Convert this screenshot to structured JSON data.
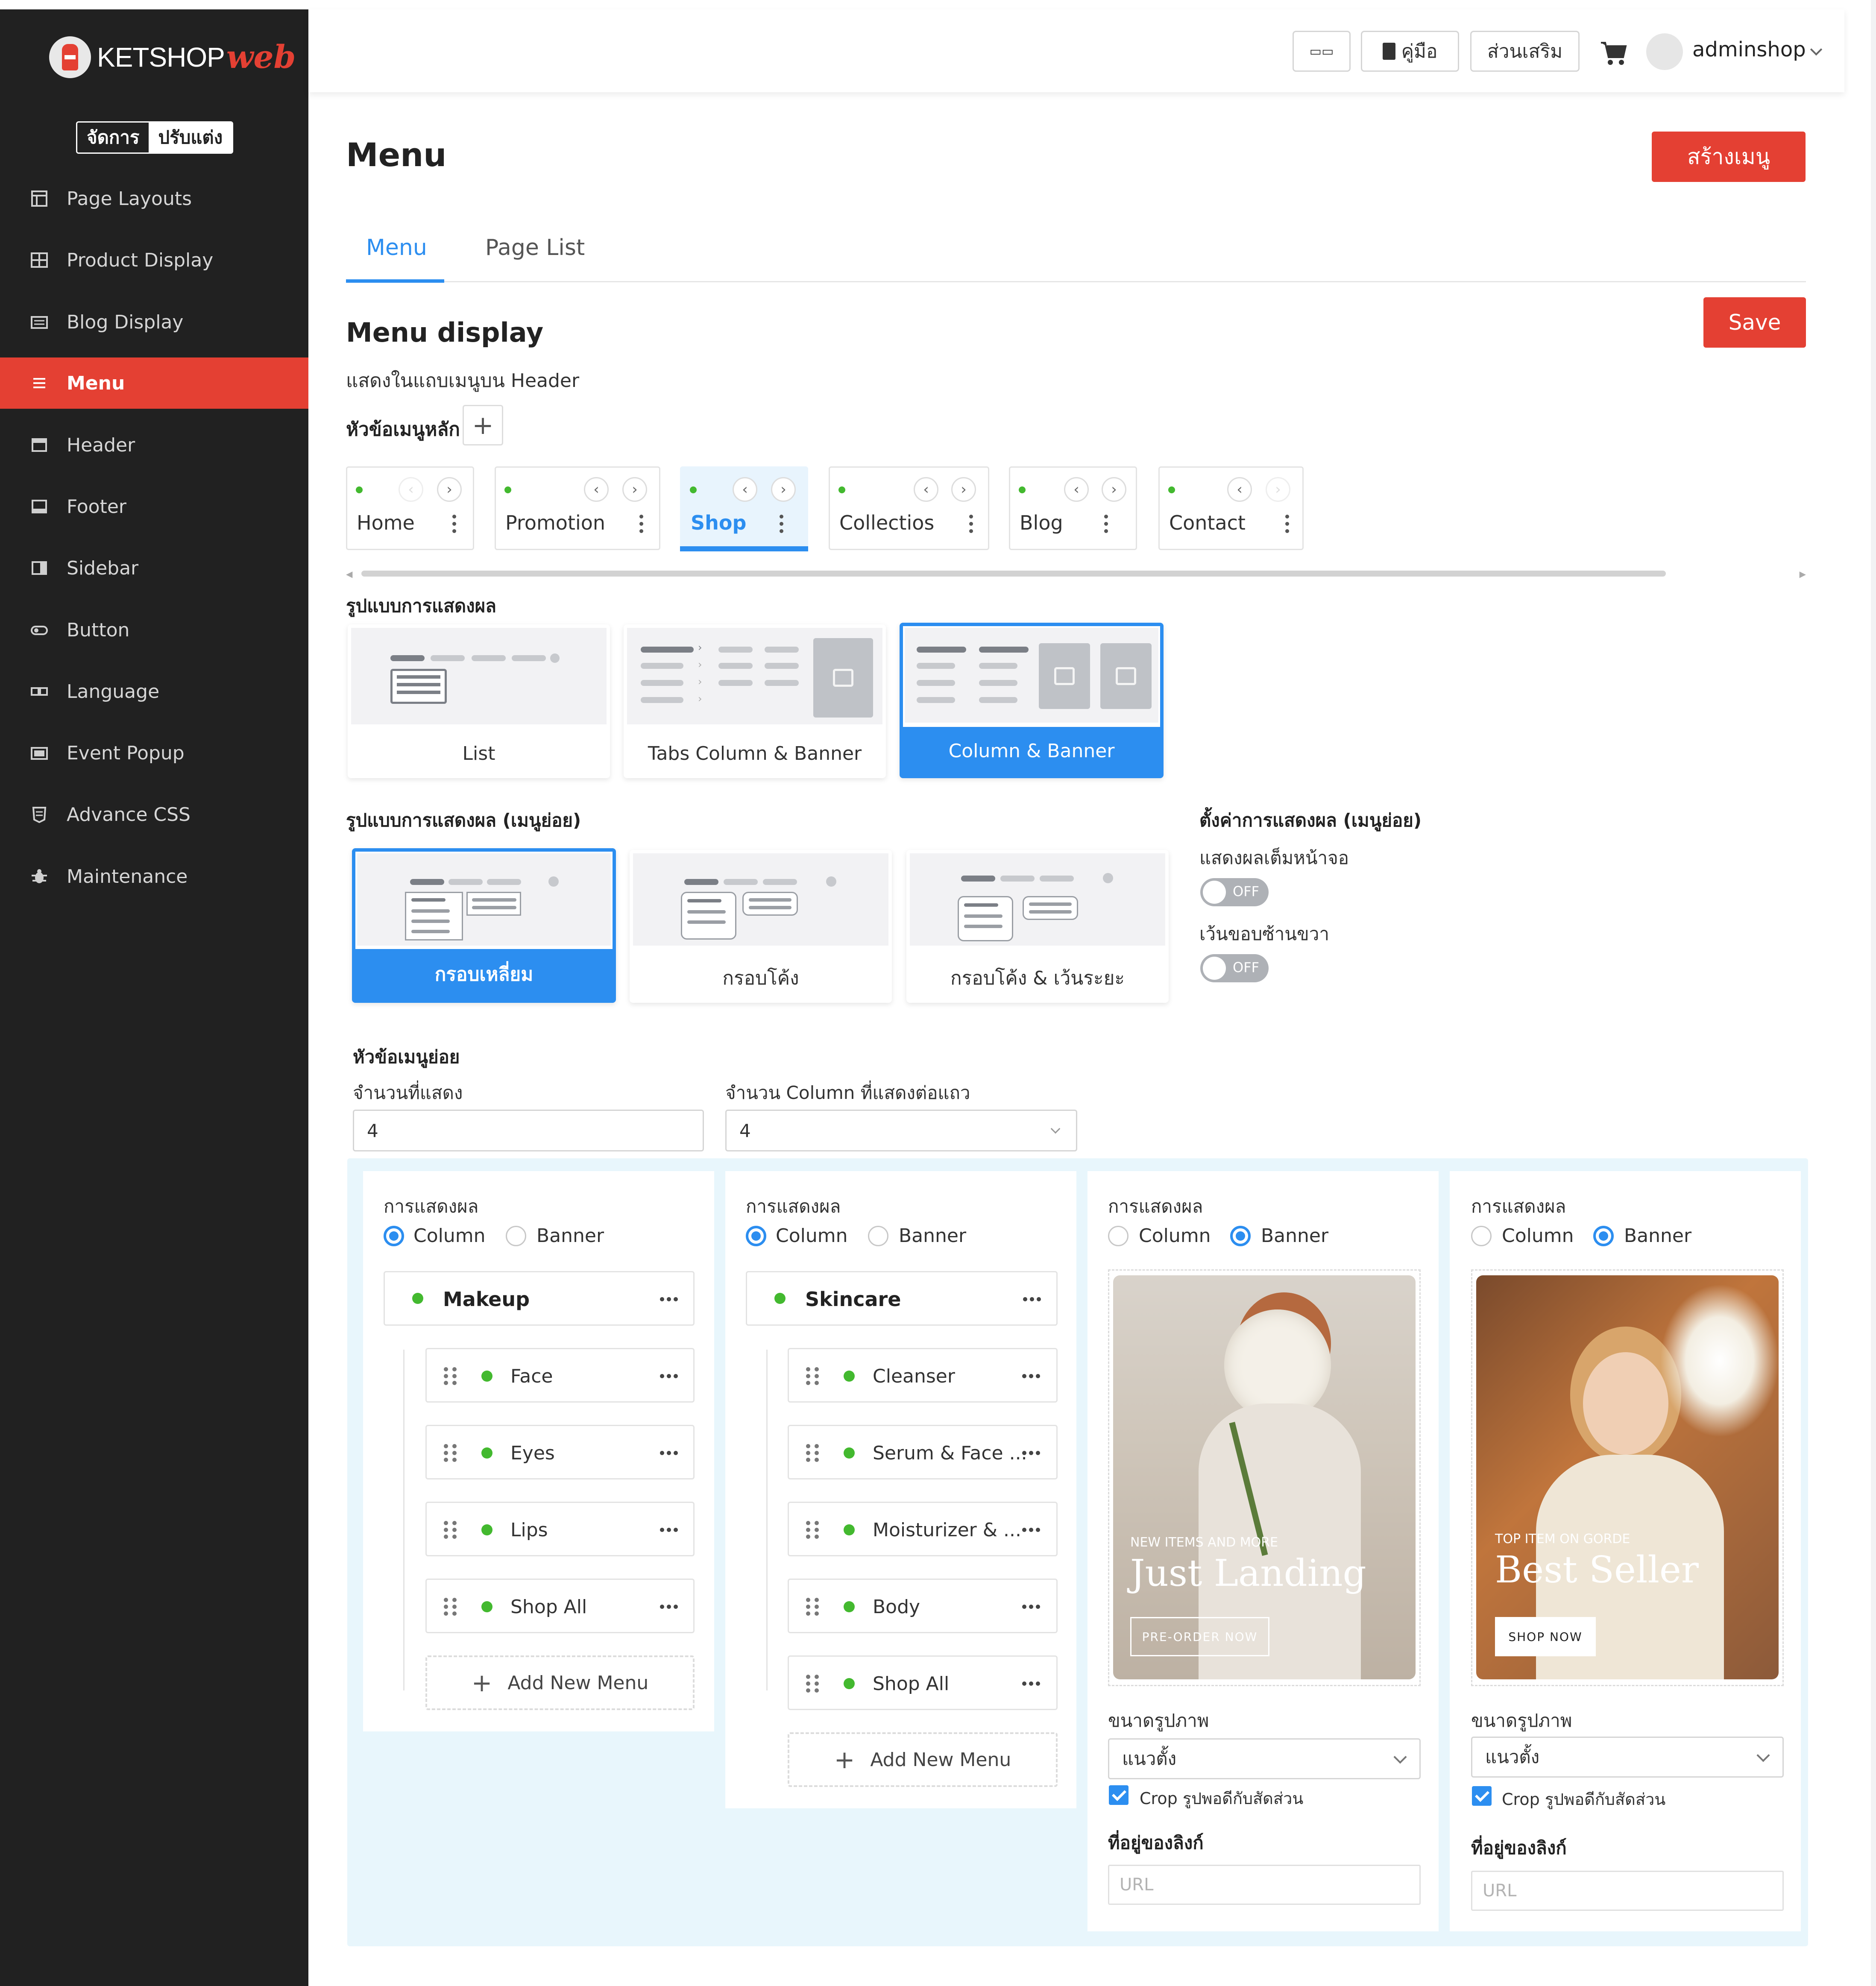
{
  "sidebar": {
    "logo_text": "KETSHOP",
    "logo_web": "web",
    "mode_manage": "จัดการ",
    "mode_customize": "ปรับแต่ง",
    "items": [
      {
        "label": "Page Layouts",
        "icon": "layout-icon"
      },
      {
        "label": "Product Display",
        "icon": "grid-icon"
      },
      {
        "label": "Blog Display",
        "icon": "blog-icon"
      },
      {
        "label": "Menu",
        "icon": "menu-icon",
        "active": true
      },
      {
        "label": "Header",
        "icon": "header-icon"
      },
      {
        "label": "Footer",
        "icon": "footer-icon"
      },
      {
        "label": "Sidebar",
        "icon": "sidebar-icon"
      },
      {
        "label": "Button",
        "icon": "button-icon"
      },
      {
        "label": "Language",
        "icon": "language-icon"
      },
      {
        "label": "Event Popup",
        "icon": "popup-icon"
      },
      {
        "label": "Advance CSS",
        "icon": "css-icon"
      },
      {
        "label": "Maintenance",
        "icon": "bug-icon"
      }
    ]
  },
  "topbar": {
    "lang_label": "▭▭",
    "manual_label": "คู่มือ",
    "addons_label": "ส่วนเสริม",
    "user_name": "adminshop"
  },
  "page": {
    "title": "Menu",
    "create_button": "สร้างเมนู",
    "tabs": [
      "Menu",
      "Page List"
    ],
    "section_title": "Menu display",
    "section_sub": "แสดงในแถบเมนูบน Header",
    "save_button": "Save",
    "main_menu_label": "หัวข้อเมนูหลัก",
    "menu_items": [
      "Home",
      "Promotion",
      "Shop",
      "Collectios",
      "Blog",
      "Contact"
    ],
    "display_style_label": "รูปแบบการแสดงผล",
    "display_styles": [
      "List",
      "Tabs Column & Banner",
      "Column & Banner"
    ],
    "sub_style_label": "รูปแบบการแสดงผล (เมนูย่อย)",
    "sub_styles": [
      "กรอบเหลี่ยม",
      "กรอบโค้ง",
      "กรอบโค้ง & เว้นระยะ"
    ],
    "sub_settings_label": "ตั้งค่าการแสดงผล (เมนูย่อย)",
    "fullscreen_label": "แสดงผลเต็มหน้าจอ",
    "right_margin_label": "เว้นขอบซ้านขวา",
    "toggle_off": "OFF",
    "submenu_label": "หัวข้อเมนูย่อย",
    "count_label": "จำนวนที่แสดง",
    "count_value": "4",
    "columns_label": "จำนวน Column ที่แสดงต่อแถว",
    "columns_value": "4"
  },
  "columns": {
    "display_label": "การแสดงผล",
    "opt_column": "Column",
    "opt_banner": "Banner",
    "add_new": "Add New Menu",
    "col1": {
      "title": "Makeup",
      "items": [
        "Face",
        "Eyes",
        "Lips",
        "Shop All"
      ]
    },
    "col2": {
      "title": "Skincare",
      "items": [
        "Cleanser",
        "Serum & Face ...",
        "Moisturizer & ...",
        "Body",
        "Shop All"
      ]
    },
    "banner_size_label": "ขนาดรูปภาพ",
    "banner_size_value": "แนวตั้ง",
    "crop_label": "Crop รูปพอดีกับสัดส่วน",
    "link_label": "ที่อยู่ของลิงก์",
    "url_placeholder": "URL",
    "banner1": {
      "kicker": "NEW ITEMS AND MORE",
      "headline": "Just Landing",
      "cta": "PRE-ORDER NOW"
    },
    "banner2": {
      "kicker": "TOP ITEM ON GORDE",
      "headline": "Best Seller",
      "cta": "SHOP NOW"
    }
  }
}
